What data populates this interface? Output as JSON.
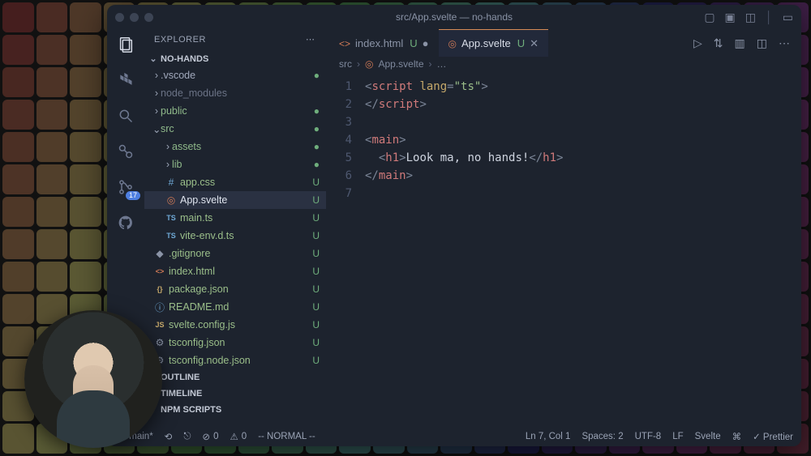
{
  "titlebar": {
    "title": "src/App.svelte — no-hands"
  },
  "activitybar": {
    "source_control_badge": "17"
  },
  "sidebar": {
    "title": "EXPLORER",
    "project": "NO-HANDS",
    "tree": [
      {
        "depth": 0,
        "kind": "folder",
        "chev": "›",
        "name": ".vscode",
        "badge": "dot",
        "color": "#a1a9bc"
      },
      {
        "depth": 0,
        "kind": "folder",
        "chev": "›",
        "name": "node_modules",
        "badge": "",
        "color": "#6b7386"
      },
      {
        "depth": 0,
        "kind": "folder",
        "chev": "›",
        "name": "public",
        "badge": "dot",
        "color": "#8fb98a"
      },
      {
        "depth": 0,
        "kind": "folder",
        "chev": "⌄",
        "name": "src",
        "badge": "dot",
        "color": "#8fb98a"
      },
      {
        "depth": 1,
        "kind": "folder",
        "chev": "›",
        "name": "assets",
        "badge": "dot",
        "color": "#8fb98a"
      },
      {
        "depth": 1,
        "kind": "folder",
        "chev": "›",
        "name": "lib",
        "badge": "dot",
        "color": "#8fb98a"
      },
      {
        "depth": 1,
        "kind": "file",
        "icon": "#",
        "iconColor": "#6fa9d6",
        "name": "app.css",
        "badge": "U",
        "selected": false
      },
      {
        "depth": 1,
        "kind": "file",
        "icon": "◎",
        "iconColor": "#d07a56",
        "name": "App.svelte",
        "badge": "U",
        "selected": true
      },
      {
        "depth": 1,
        "kind": "file",
        "icon": "TS",
        "iconColor": "#6fa9d6",
        "name": "main.ts",
        "badge": "U",
        "selected": false
      },
      {
        "depth": 1,
        "kind": "file",
        "icon": "TS",
        "iconColor": "#6fa9d6",
        "name": "vite-env.d.ts",
        "badge": "U",
        "selected": false
      },
      {
        "depth": 0,
        "kind": "file",
        "icon": "◆",
        "iconColor": "#8a93a6",
        "name": ".gitignore",
        "badge": "U",
        "selected": false
      },
      {
        "depth": 0,
        "kind": "file",
        "icon": "<>",
        "iconColor": "#d07a56",
        "name": "index.html",
        "badge": "U",
        "selected": false
      },
      {
        "depth": 0,
        "kind": "file",
        "icon": "{}",
        "iconColor": "#c5a86a",
        "name": "package.json",
        "badge": "U",
        "selected": false
      },
      {
        "depth": 0,
        "kind": "file",
        "icon": "ⓘ",
        "iconColor": "#6fa9d6",
        "name": "README.md",
        "badge": "U",
        "selected": false
      },
      {
        "depth": 0,
        "kind": "file",
        "icon": "JS",
        "iconColor": "#c5a86a",
        "name": "svelte.config.js",
        "badge": "U",
        "selected": false
      },
      {
        "depth": 0,
        "kind": "file",
        "icon": "⚙",
        "iconColor": "#8a93a6",
        "name": "tsconfig.json",
        "badge": "U",
        "selected": false
      },
      {
        "depth": 0,
        "kind": "file",
        "icon": "⚙",
        "iconColor": "#8a93a6",
        "name": "tsconfig.node.json",
        "badge": "U",
        "selected": false
      }
    ],
    "sections": {
      "outline": "OUTLINE",
      "timeline": "TIMELINE",
      "npm": "NPM SCRIPTS"
    }
  },
  "tabs": [
    {
      "icon": "<>",
      "iconColor": "#d07a56",
      "label": "index.html",
      "badge": "U",
      "active": false,
      "dirty": true
    },
    {
      "icon": "◎",
      "iconColor": "#d07a56",
      "label": "App.svelte",
      "badge": "U",
      "active": true,
      "dirty": false
    }
  ],
  "breadcrumb": {
    "parts": [
      "src",
      "App.svelte",
      "…"
    ]
  },
  "code": {
    "lines": [
      {
        "n": 1,
        "tokens": [
          [
            "punc",
            "<"
          ],
          [
            "tag",
            "script"
          ],
          [
            "text",
            " "
          ],
          [
            "attr",
            "lang"
          ],
          [
            "punc",
            "="
          ],
          [
            "str",
            "\"ts\""
          ],
          [
            "punc",
            ">"
          ]
        ]
      },
      {
        "n": 2,
        "tokens": [
          [
            "punc",
            "</"
          ],
          [
            "tag",
            "script"
          ],
          [
            "punc",
            ">"
          ]
        ]
      },
      {
        "n": 3,
        "tokens": []
      },
      {
        "n": 4,
        "tokens": [
          [
            "punc",
            "<"
          ],
          [
            "tag",
            "main"
          ],
          [
            "punc",
            ">"
          ]
        ]
      },
      {
        "n": 5,
        "tokens": [
          [
            "text",
            "  "
          ],
          [
            "punc",
            "<"
          ],
          [
            "tag",
            "h1"
          ],
          [
            "punc",
            ">"
          ],
          [
            "text",
            "Look ma, no hands!"
          ],
          [
            "punc",
            "</"
          ],
          [
            "tag",
            "h1"
          ],
          [
            "punc",
            ">"
          ]
        ]
      },
      {
        "n": 6,
        "tokens": [
          [
            "punc",
            "</"
          ],
          [
            "tag",
            "main"
          ],
          [
            "punc",
            ">"
          ]
        ]
      },
      {
        "n": 7,
        "tokens": []
      }
    ]
  },
  "statusbar": {
    "branch": "main*",
    "sync": "⟲",
    "remote": "⎋",
    "errors": "0",
    "warnings": "0",
    "mode": "-- NORMAL --",
    "pos": "Ln 7, Col 1",
    "spaces": "Spaces: 2",
    "encoding": "UTF-8",
    "eol": "LF",
    "lang": "Svelte",
    "copilot": "⌘",
    "prettier": "✓ Prettier"
  }
}
